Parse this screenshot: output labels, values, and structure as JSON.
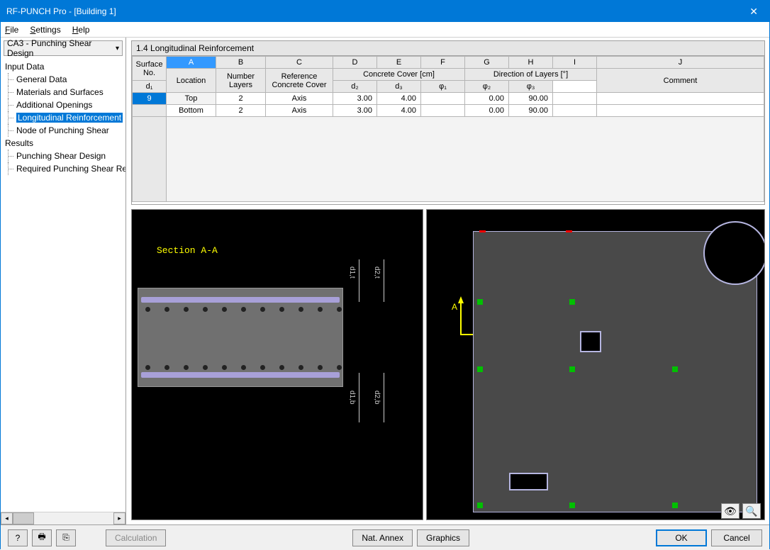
{
  "window": {
    "title": "RF-PUNCH Pro - [Building 1]",
    "close": "✕"
  },
  "menu": {
    "file": "File",
    "settings": "Settings",
    "help": "Help"
  },
  "sidebar": {
    "case": "CA3 - Punching Shear Design",
    "input_header": "Input Data",
    "items": [
      "General Data",
      "Materials and Surfaces",
      "Additional Openings",
      "Longitudinal Reinforcement",
      "Node of Punching Shear"
    ],
    "results_header": "Results",
    "results": [
      "Punching Shear Design",
      "Required Punching Shear Reinf"
    ]
  },
  "main": {
    "title": "1.4 Longitudinal Reinforcement",
    "cols": {
      "A": "A",
      "B": "B",
      "C": "C",
      "D": "D",
      "E": "E",
      "F": "F",
      "G": "G",
      "H": "H",
      "I": "I",
      "J": "J"
    },
    "group": {
      "surface": "Surface\nNo.",
      "location": "Location",
      "numlayers": "Number\nLayers",
      "ref": "Reference\nConcrete Cover",
      "cover": "Concrete Cover [cm]",
      "dir": "Direction of Layers [°]",
      "comment": "Comment",
      "d1": "d₁",
      "d2": "d₂",
      "d3": "d₃",
      "p1": "φ₁",
      "p2": "φ₂",
      "p3": "φ₃"
    },
    "rows": [
      {
        "no": "9",
        "loc": "Top",
        "nl": "2",
        "ref": "Axis",
        "d1": "3.00",
        "d2": "4.00",
        "d3": "",
        "p1": "0.00",
        "p2": "90.00",
        "p3": "",
        "c": ""
      },
      {
        "no": "",
        "loc": "Bottom",
        "nl": "2",
        "ref": "Axis",
        "d1": "3.00",
        "d2": "4.00",
        "d3": "",
        "p1": "0.00",
        "p2": "90.00",
        "p3": "",
        "c": ""
      }
    ]
  },
  "viz": {
    "section": "Section A-A",
    "d1t": "d1,t",
    "d2t": "d2,t",
    "d1b": "d1,b",
    "d2b": "d2,b",
    "A": "A"
  },
  "footer": {
    "help": "?",
    "calc": "Calculation",
    "annex": "Nat. Annex",
    "graphics": "Graphics",
    "ok": "OK",
    "cancel": "Cancel"
  }
}
